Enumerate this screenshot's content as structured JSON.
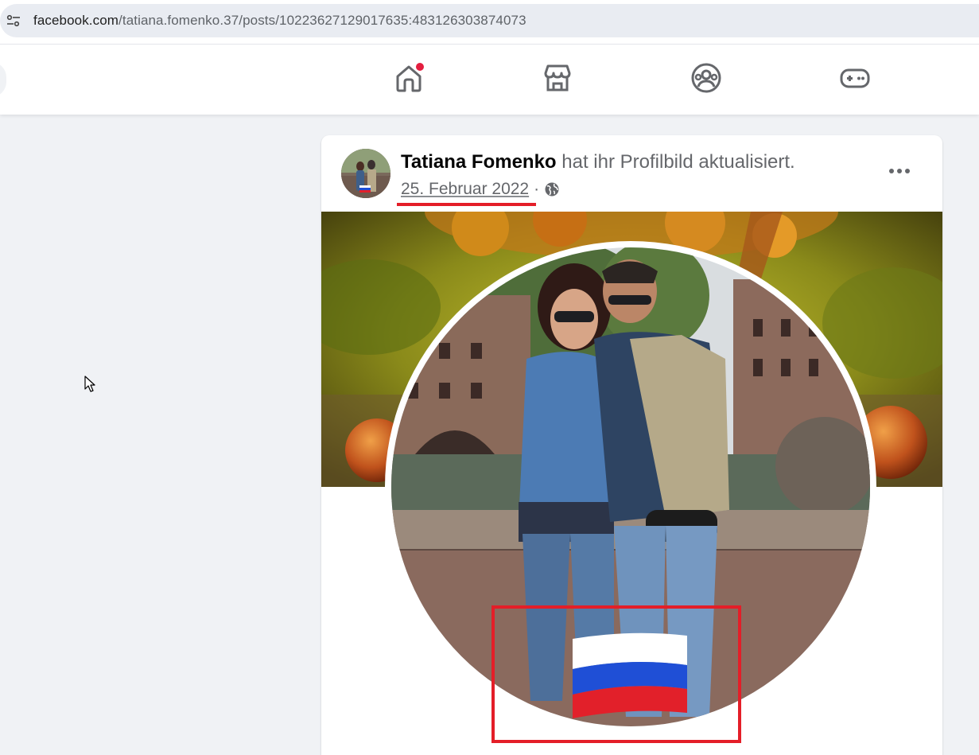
{
  "browser": {
    "url_host": "facebook.com",
    "url_path": "/tatiana.fomenko.37/posts/10223627129017635:483126303874073",
    "site_info_icon": "tune-icon"
  },
  "fb_nav": {
    "items": [
      {
        "name": "home-icon",
        "label": "Home",
        "has_notification": true
      },
      {
        "name": "marketplace-icon",
        "label": "Marketplace"
      },
      {
        "name": "groups-icon",
        "label": "Groups"
      },
      {
        "name": "gaming-icon",
        "label": "Gaming"
      }
    ],
    "notification_color": "#e41e3f"
  },
  "post": {
    "author": "Tatiana Fomenko",
    "action": "hat ihr Profilbild aktualisiert.",
    "date": "25. Februar 2022",
    "separator": "·",
    "audience_icon": "globe-icon",
    "more_icon": "more-horizontal-icon"
  },
  "annotations": {
    "highlight_color": "#e41e28"
  }
}
